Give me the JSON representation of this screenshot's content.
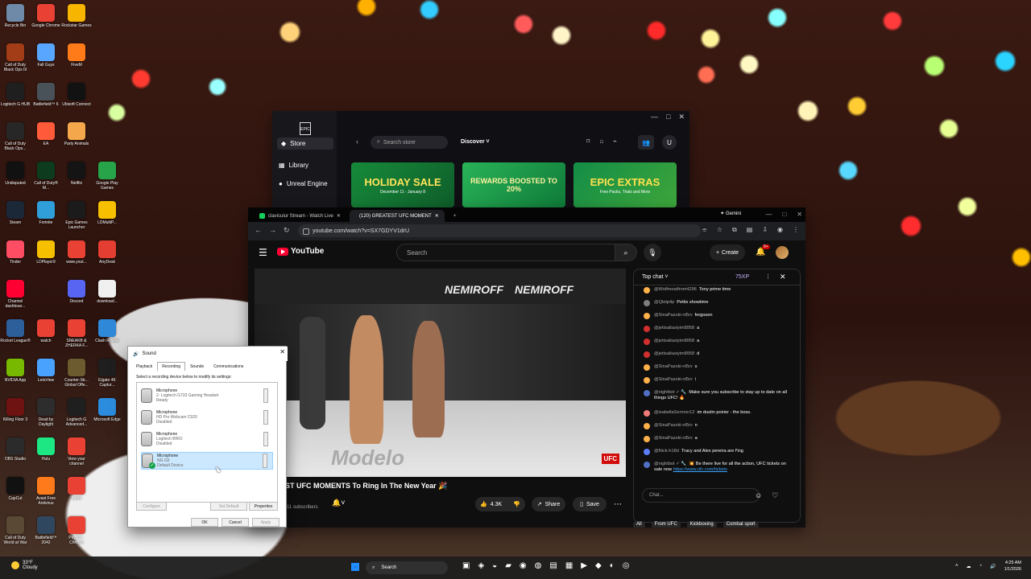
{
  "desktop": {
    "icons": [
      {
        "label": "Recycle Bin",
        "icon": "recycle-bin-icon",
        "color": "#6e8aa8",
        "x": 0,
        "y": 0
      },
      {
        "label": "Google Chrome",
        "icon": "chrome-icon",
        "color": "#e94235",
        "x": 1,
        "y": 0
      },
      {
        "label": "Rockstar Games",
        "icon": "rockstar-icon",
        "color": "#f7b500",
        "x": 2,
        "y": 0
      },
      {
        "label": "Call of Duty Black Ops III",
        "icon": "cod-icon",
        "color": "#a33d18",
        "x": 0,
        "y": 1
      },
      {
        "label": "Fall Guys",
        "icon": "fall-guys-icon",
        "color": "#58a6ff",
        "x": 1,
        "y": 1
      },
      {
        "label": "FiveM",
        "icon": "fivem-icon",
        "color": "#ff7b1a",
        "x": 2,
        "y": 1
      },
      {
        "label": "Logitech G HUB",
        "icon": "logitech-icon",
        "color": "#1f1f1f",
        "x": 0,
        "y": 2
      },
      {
        "label": "Battlefield™ 6",
        "icon": "battlefield-icon",
        "color": "#4a5259",
        "x": 1,
        "y": 2
      },
      {
        "label": "Ubisoft Connect",
        "icon": "ubisoft-icon",
        "color": "#121212",
        "x": 2,
        "y": 2
      },
      {
        "label": "Call of Duty Black Ops...",
        "icon": "cod-icon",
        "color": "#272727",
        "x": 0,
        "y": 3
      },
      {
        "label": "EA",
        "icon": "ea-icon",
        "color": "#ff5b3a",
        "x": 1,
        "y": 3
      },
      {
        "label": "Party Animals",
        "icon": "party-animals-icon",
        "color": "#f4a84b",
        "x": 2,
        "y": 3
      },
      {
        "label": "Undisputed",
        "icon": "undisputed-icon",
        "color": "#111111",
        "x": 0,
        "y": 4
      },
      {
        "label": "Call of Duty® M...",
        "icon": "mw-icon",
        "color": "#0d3b1e",
        "x": 1,
        "y": 4
      },
      {
        "label": "Netflix",
        "icon": "netflix-icon",
        "color": "#141414",
        "x": 2,
        "y": 4
      },
      {
        "label": "Google Play Games",
        "icon": "google-play-icon",
        "color": "#27a34a",
        "x": 3,
        "y": 4
      },
      {
        "label": "Steam",
        "icon": "steam-icon",
        "color": "#1b2838",
        "x": 0,
        "y": 5
      },
      {
        "label": "Fortnite",
        "icon": "fortnite-icon",
        "color": "#2f9ed9",
        "x": 1,
        "y": 5
      },
      {
        "label": "Epic Games Launcher",
        "icon": "epic-icon",
        "color": "#1b1b1b",
        "x": 2,
        "y": 5
      },
      {
        "label": "LDMultiP...",
        "icon": "ldplayer-icon",
        "color": "#f6c000",
        "x": 3,
        "y": 5
      },
      {
        "label": "Tinder",
        "icon": "tinder-icon",
        "color": "#ff4d63",
        "x": 0,
        "y": 6
      },
      {
        "label": "LDPlayer9",
        "icon": "ldplayer-icon",
        "color": "#f6c000",
        "x": 1,
        "y": 6
      },
      {
        "label": "www.yout...",
        "icon": "chrome-icon",
        "color": "#e94235",
        "x": 2,
        "y": 6
      },
      {
        "label": "AnyDesk",
        "icon": "anydesk-icon",
        "color": "#e43d31",
        "x": 3,
        "y": 6
      },
      {
        "label": "Channel dashboar...",
        "icon": "youtube-icon",
        "color": "#ff0033",
        "x": 0,
        "y": 7
      },
      {
        "label": "Discord",
        "icon": "discord-icon",
        "color": "#5865f2",
        "x": 2,
        "y": 7
      },
      {
        "label": "download...",
        "icon": "download-icon",
        "color": "#f0f0f0",
        "x": 3,
        "y": 7
      },
      {
        "label": "Rocket League®",
        "icon": "rocket-league-icon",
        "color": "#2d5f9a",
        "x": 0,
        "y": 8
      },
      {
        "label": "watch",
        "icon": "chrome-icon",
        "color": "#e94235",
        "x": 1,
        "y": 8
      },
      {
        "label": "SNEAKB & ZHERKA F...",
        "icon": "chrome-icon",
        "color": "#e94235",
        "x": 2,
        "y": 8
      },
      {
        "label": "Clash Royale",
        "icon": "clash-royale-icon",
        "color": "#2f88d8",
        "x": 3,
        "y": 8
      },
      {
        "label": "NVIDIA App",
        "icon": "nvidia-icon",
        "color": "#76b900",
        "x": 0,
        "y": 9
      },
      {
        "label": "LetsView",
        "icon": "letsview-icon",
        "color": "#4aa2ff",
        "x": 1,
        "y": 9
      },
      {
        "label": "Counter-Str... Global Offe...",
        "icon": "csgo-icon",
        "color": "#6b5b2e",
        "x": 2,
        "y": 9
      },
      {
        "label": "Elgato 4K Captur...",
        "icon": "elgato-icon",
        "color": "#1f1f1f",
        "x": 3,
        "y": 9
      },
      {
        "label": "Killing Floor 3",
        "icon": "killing-floor-icon",
        "color": "#6f1212",
        "x": 0,
        "y": 10
      },
      {
        "label": "Dead by Daylight",
        "icon": "dbd-icon",
        "color": "#2d2d2d",
        "x": 1,
        "y": 10
      },
      {
        "label": "Logitech G Advanced...",
        "icon": "logitech-icon",
        "color": "#1f1f1f",
        "x": 2,
        "y": 10
      },
      {
        "label": "Microsoft Edge",
        "icon": "edge-icon",
        "color": "#2c8cde",
        "x": 3,
        "y": 10
      },
      {
        "label": "OBS Studio",
        "icon": "obs-icon",
        "color": "#2b2b2b",
        "x": 0,
        "y": 11
      },
      {
        "label": "Hulu",
        "icon": "hulu-icon",
        "color": "#1ce783",
        "x": 1,
        "y": 11
      },
      {
        "label": "View your channel",
        "icon": "chrome-icon",
        "color": "#e94235",
        "x": 2,
        "y": 11
      },
      {
        "label": "CapCut",
        "icon": "capcut-icon",
        "color": "#111111",
        "x": 0,
        "y": 12
      },
      {
        "label": "Avast Free Antivirus",
        "icon": "avast-icon",
        "color": "#ff7a1a",
        "x": 1,
        "y": 12
      },
      {
        "label": "home",
        "icon": "chrome-icon",
        "color": "#e94235",
        "x": 2,
        "y": 12
      },
      {
        "label": "Call of Duty World at War",
        "icon": "cod-icon",
        "color": "#5a4a35",
        "x": 0,
        "y": 13
      },
      {
        "label": "Battlefield™ 2042",
        "icon": "battlefield-icon",
        "color": "#30485f",
        "x": 1,
        "y": 13
      },
      {
        "label": "Psycho - Chrome",
        "icon": "chrome-icon",
        "color": "#e94235",
        "x": 2,
        "y": 13
      }
    ]
  },
  "epic": {
    "brand_short": "EPIC",
    "sidebar": {
      "store": "Store",
      "library": "Library",
      "unreal_engine": "Unreal Engine"
    },
    "search_placeholder": "Search store",
    "discover": "Discover",
    "avatar_letter": "U",
    "promos": [
      {
        "title": "HOLIDAY SALE",
        "subtitle": "December 11 - January 8"
      },
      {
        "title": "REWARDS BOOSTED TO 20%",
        "subtitle": ""
      },
      {
        "title": "EPIC EXTRAS",
        "subtitle": "Free Packs, Trials and More"
      }
    ]
  },
  "browser": {
    "tabs": [
      {
        "label": "claviculur Stream - Watch Live",
        "color": "#14d05a"
      },
      {
        "label": "(120) GREATEST UFC MOMENT",
        "color": "#ff0033"
      }
    ],
    "assistant": "Gemini",
    "url": "youtube.com/watch?v=SX7GDYV1drU"
  },
  "youtube": {
    "brand": "YouTube",
    "search_placeholder": "Search",
    "create_label": "Create",
    "notification_badge": "9+",
    "video": {
      "overlay_text": "NEMIROFF",
      "floor_text": "Modelo",
      "logo": "UFC",
      "title": "ST UFC MOMENTS To Ring In The New Year 🎉",
      "subscribers": "11 subscribers"
    },
    "actions": {
      "likes": "4.3K",
      "share": "Share",
      "save": "Save"
    },
    "chat": {
      "label": "Top chat",
      "xp": "75XP",
      "input_placeholder": "Chat...",
      "messages": [
        {
          "name": "@Wolfmeatfrom4296",
          "text": "Tony prime time",
          "color": "#ffb14a"
        },
        {
          "name": "@Qletp4p",
          "text": "Pettis showtime",
          "color": "#7e7e7e"
        },
        {
          "name": "@SinaPazoki-nl5rv",
          "text": "fergosen",
          "color": "#ffb14a"
        },
        {
          "name": "@jettsaltasiyim8958",
          "text": "a",
          "color": "#d32f2f"
        },
        {
          "name": "@jettsaltasiyim8958",
          "text": "a",
          "color": "#d32f2f"
        },
        {
          "name": "@jettsaltasiyim8958",
          "text": "d",
          "color": "#d32f2f"
        },
        {
          "name": "@SinaPazoki-nl5rv",
          "text": "s",
          "color": "#ffb14a"
        },
        {
          "name": "@SinaPazoki-nl5rv",
          "text": "i",
          "color": "#ffb14a"
        },
        {
          "name": "@nightbot ✓ 🔧",
          "text": "Make sure you subscribe to stay up to date on all things UFC! 🔥",
          "color": "#4f70c6"
        },
        {
          "name": "@isabellaSermon12",
          "text": "im dustin poirier - the boss.",
          "color": "#f17a7a"
        },
        {
          "name": "@SinaPazoki-nl5rv",
          "text": "n",
          "color": "#ffb14a"
        },
        {
          "name": "@SinaPazoki-nl5rv",
          "text": "a",
          "color": "#ffb14a"
        },
        {
          "name": "@Nick-h18d",
          "text": "Tracy and Alex pereira are f'ing",
          "color": "#5c7cfa"
        },
        {
          "name": "@nightbot ✓ 🔧",
          "text": "💥 Be there live for all the action, UFC tickets on sale now ",
          "link": "https://www.ufc.com/tickets",
          "color": "#4f70c6"
        }
      ],
      "chips": [
        "All",
        "From UFC",
        "Kickboxing",
        "Combat sport"
      ]
    }
  },
  "sound": {
    "title": "Sound",
    "tabs": [
      "Playback",
      "Recording",
      "Sounds",
      "Communications"
    ],
    "instruction": "Select a recording device below to modify its settings:",
    "devices": [
      {
        "name": "Microphone",
        "desc": "2- Logitech G733 Gaming Headset",
        "state": "Ready",
        "default": false,
        "selected": false
      },
      {
        "name": "Microphone",
        "desc": "HD Pro Webcam C920",
        "state": "Disabled",
        "default": false,
        "selected": false
      },
      {
        "name": "Microphone",
        "desc": "Logitech BRIO",
        "state": "Disabled",
        "default": false,
        "selected": false
      },
      {
        "name": "Microphone",
        "desc": "NG G5",
        "state": "Default Device",
        "default": true,
        "selected": true
      }
    ],
    "buttons": {
      "configure": "Configure",
      "set_default": "Set Default",
      "properties": "Properties",
      "ok": "OK",
      "cancel": "Cancel",
      "apply": "Apply"
    }
  },
  "taskbar": {
    "weather": {
      "temp": "33°F",
      "condition": "Cloudy"
    },
    "search": "Search",
    "time": "4:25 AM",
    "date": "1/1/2026"
  }
}
